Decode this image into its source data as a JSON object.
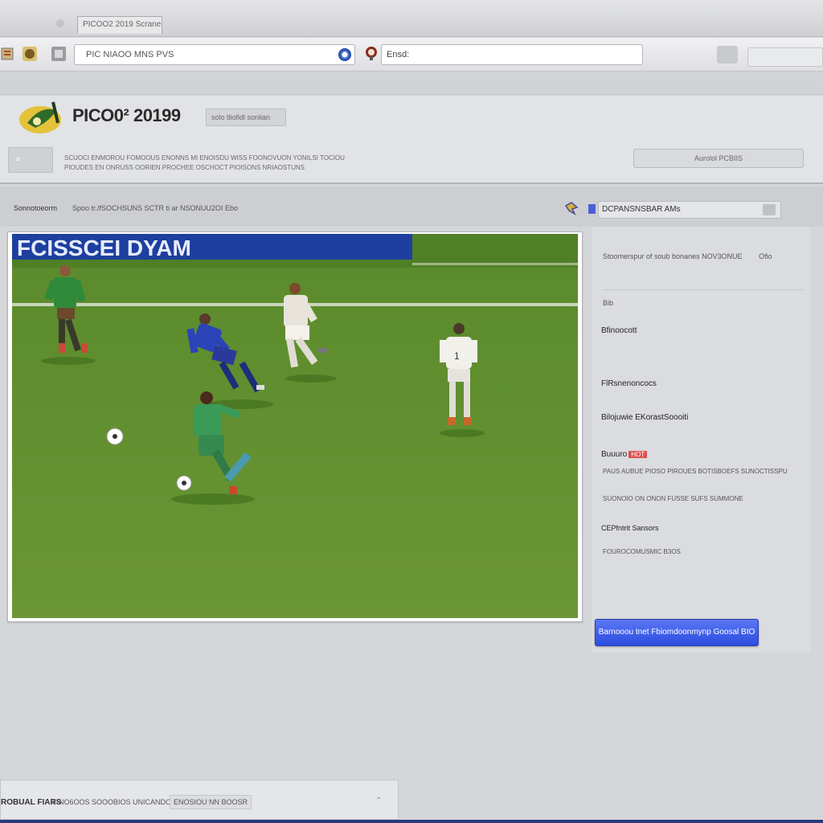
{
  "window": {
    "title": "",
    "tab_label": "PICOO2 2019 Scrane"
  },
  "toolbar": {
    "address": "PIC NIAOO MNS PVS",
    "search_label": "Ensd:"
  },
  "header": {
    "site_title": "PICO0² 20199",
    "tag": "solo tliofidl sonlian",
    "thumb_label": "≡",
    "description_line1": "SCUOCI ENMOROU FOMOOUS ENONNS MI ENOISDU WISS FOONOVUON YONILSI TOCIOU",
    "description_line2": "PIOUDES EN ONRUSS OORIEN PROCHEE OSCHOCT PIOISONS NRIAOSTUNS",
    "right_button": "Aurolol PCBIIS"
  },
  "nav": {
    "left": "Sonnotoeorm",
    "breadcrumb": "Spoo tr./fSOCHSUNS SCTR ti ar NSONUU2OI Ebo",
    "search_text": "DCPANSNSBAR AMs"
  },
  "video": {
    "banner_text": "FCISSCEI DYAM",
    "ball_color": "#ffffff"
  },
  "sidebar": {
    "line1": "Stoomerspur of soub bonanes NOV3ONUE",
    "line1_tail": "Ofio",
    "label_a": "Bib",
    "label_b": "Bfinoocott",
    "label_c": "FlRsnenoncocs",
    "label_d": "Bilojuwie EKorastSoooiti",
    "label_e": "Buuuro",
    "badge": "HOT",
    "line_f": "PAUS AUBUE PIOSO PIROUES BOTISBOEFS SUNOCTISSPU",
    "line_g": "SUONOIO ON ONON FUSSE SUFS SUMMONE",
    "label_h": "CEPfntrit Sansors",
    "line_i": "FOUROCOMUSMIC B3OS"
  },
  "download_button": "Barnooou tnet Fbiomdoonmynp Goosal BIO",
  "status": {
    "left": "ROBUAL FIARS",
    "middle": "FINO6OOS SOOOBIOS UNICANDO",
    "chip": "ENOSIOU NN BOOSR",
    "right": "⌃"
  },
  "colors": {
    "accent": "#3a5ae8",
    "pitch": "#5c8a2e",
    "header_bg": "#e2e3e6"
  }
}
